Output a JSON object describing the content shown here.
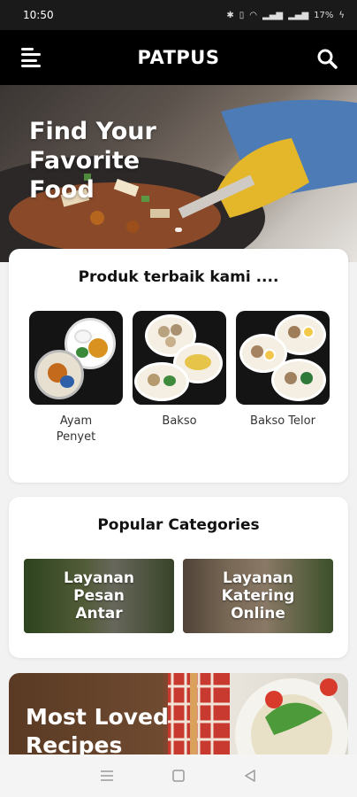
{
  "status_bar": {
    "time": "10:50",
    "battery": "17%"
  },
  "app_bar": {
    "title": "PATPUS"
  },
  "hero": {
    "title": "Find Your\nFavorite\nFood"
  },
  "products": {
    "title": "Produk terbaik kami ....",
    "items": [
      {
        "label": "Ayam\nPenyet"
      },
      {
        "label": "Bakso"
      },
      {
        "label": "Bakso Telor"
      }
    ]
  },
  "categories": {
    "title": "Popular Categories",
    "items": [
      {
        "label": "Layanan\nPesan\nAntar"
      },
      {
        "label": "Layanan\nKatering\nOnline"
      }
    ]
  },
  "most_loved": {
    "title": "Most Loved\nRecipes"
  },
  "colors": {
    "app_bar": "#000000",
    "background": "#f2f2f2",
    "card": "#ffffff"
  },
  "icons": {
    "menu": "menu-icon",
    "search": "search-icon",
    "recent": "recent-apps-icon",
    "home": "home-icon",
    "back": "back-icon"
  }
}
